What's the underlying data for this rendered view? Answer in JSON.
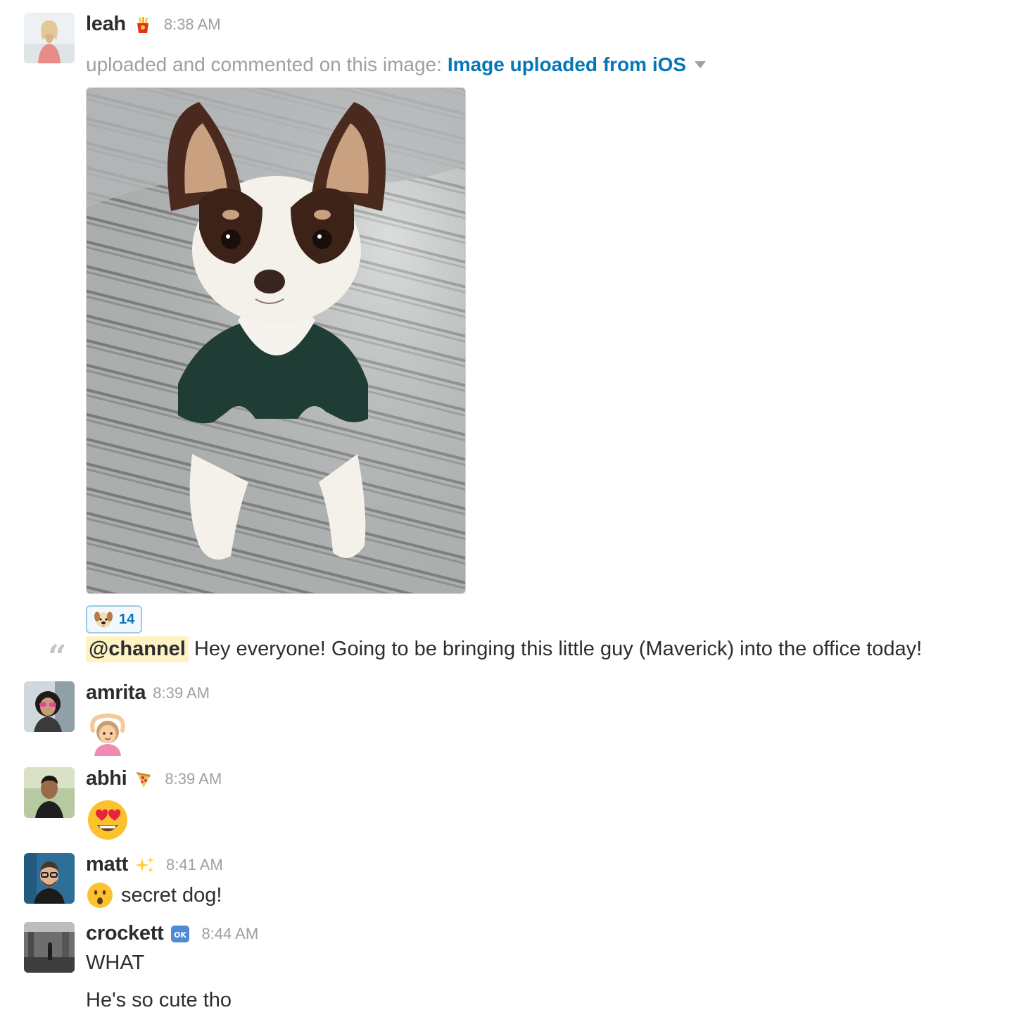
{
  "messages": [
    {
      "sender": "leah",
      "status_icon": "fries-icon",
      "time": "8:38 AM",
      "file_action": "uploaded and commented on this image:",
      "file_link": "Image uploaded from iOS",
      "reaction": {
        "icon": "dog-face-icon",
        "count": "14"
      },
      "comment_mention": "@channel",
      "comment_text": "Hey everyone! Going to be bringing this little guy (Maverick) into the office today!"
    },
    {
      "sender": "amrita",
      "time": "8:39 AM",
      "body_icon": "woman-gesturing-ok-icon"
    },
    {
      "sender": "abhi",
      "status_icon": "pizza-icon",
      "time": "8:39 AM",
      "body_icon": "heart-eyes-icon"
    },
    {
      "sender": "matt",
      "status_icon": "sparkles-icon",
      "time": "8:41 AM",
      "body_icon": "surprised-face-icon",
      "body_text": "secret dog!"
    },
    {
      "sender": "crockett",
      "status_icon": "ok-button-icon",
      "time": "8:44 AM",
      "lines": [
        "WHAT",
        "He's so cute tho"
      ]
    }
  ],
  "colors": {
    "link": "#0576b9",
    "muted": "#9e9ea6",
    "mention_bg": "#fff3c4",
    "reaction_border": "#9ec9e8"
  }
}
